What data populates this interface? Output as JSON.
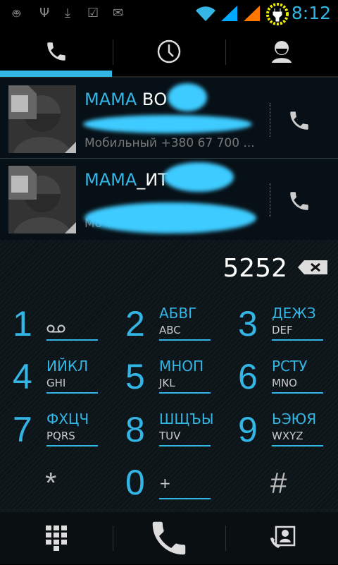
{
  "status": {
    "time": "8:12",
    "icons": [
      "android-debug-icon",
      "usb-icon",
      "download-icon",
      "market-update-icon",
      "gmail-icon",
      "wifi-icon",
      "signal-icon",
      "signal-icon-2",
      "battery-charging-icon"
    ]
  },
  "tabs": [
    {
      "name": "dialer",
      "active": true
    },
    {
      "name": "call-log"
    },
    {
      "name": "contacts"
    }
  ],
  "suggestions": [
    {
      "name_match": "МАМА",
      "name_rest": " ВО",
      "detail": "Мобильный +380 67 700 ..."
    },
    {
      "name_match": "МАМА",
      "name_rest": "_ИТ",
      "detail": "Мо                                  7 ..."
    }
  ],
  "dial_number": "5252",
  "keypad": [
    {
      "digit": "1",
      "top": "",
      "bottom": "voicemail"
    },
    {
      "digit": "2",
      "top": "АБВГ",
      "bottom": "ABC"
    },
    {
      "digit": "3",
      "top": "ДЕЖЗ",
      "bottom": "DEF"
    },
    {
      "digit": "4",
      "top": "ИЙКЛ",
      "bottom": "GHI"
    },
    {
      "digit": "5",
      "top": "МНОП",
      "bottom": "JKL"
    },
    {
      "digit": "6",
      "top": "РСТУ",
      "bottom": "MNO"
    },
    {
      "digit": "7",
      "top": "ФХЦЧ",
      "bottom": "PQRS"
    },
    {
      "digit": "8",
      "top": "ШЩЪЫ",
      "bottom": "TUV"
    },
    {
      "digit": "9",
      "top": "ЬЭЮЯ",
      "bottom": "WXYZ"
    },
    {
      "digit": "*",
      "top": "",
      "bottom": ""
    },
    {
      "digit": "0",
      "top": "+",
      "bottom": ""
    },
    {
      "digit": "#",
      "top": "",
      "bottom": ""
    }
  ],
  "colors": {
    "accent": "#33b5e5",
    "background": "#000000"
  }
}
